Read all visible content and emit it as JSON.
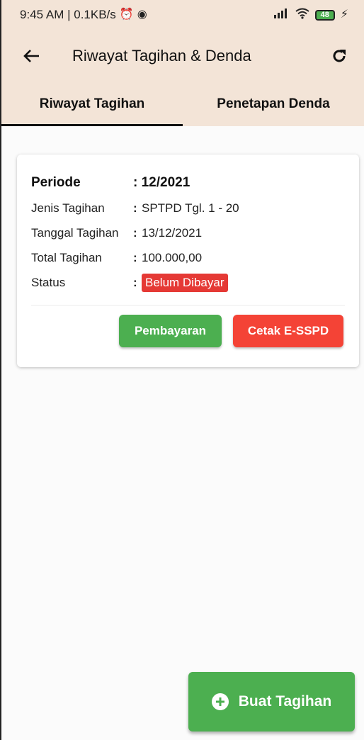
{
  "status_bar": {
    "time_speed": "9:45 AM | 0.1KB/s",
    "alarm_icon": "alarm-clock-icon",
    "app_icon": "app-notification-icon",
    "signal_icon": "signal-icon",
    "wifi_icon": "wifi-icon",
    "battery_level": "48",
    "charging_icon": "lightning-icon"
  },
  "appbar": {
    "back_icon": "arrow-left-icon",
    "title": "Riwayat Tagihan & Denda",
    "refresh_icon": "refresh-icon"
  },
  "tabs": [
    {
      "label": "Riwayat Tagihan",
      "active": true
    },
    {
      "label": "Penetapan Denda",
      "active": false
    }
  ],
  "card": {
    "periode_label": "Periode",
    "periode_value": ": 12/2021",
    "rows": [
      {
        "label": "Jenis Tagihan",
        "colon": ":",
        "value": "SPTPD Tgl. 1 - 20"
      },
      {
        "label": "Tanggal Tagihan",
        "colon": ":",
        "value": "13/12/2021"
      },
      {
        "label": "Total Tagihan",
        "colon": ":",
        "value": "100.000,00"
      }
    ],
    "status_label": "Status",
    "status_colon": ":",
    "status_value": "Belum Dibayar",
    "pay_button": "Pembayaran",
    "print_button": "Cetak E-SSPD"
  },
  "fab": {
    "icon": "plus-circle-icon",
    "label": "Buat Tagihan"
  },
  "colors": {
    "header_bg": "#f3e4d7",
    "green": "#4caf50",
    "red": "#f44336",
    "badge_red": "#e53935"
  }
}
